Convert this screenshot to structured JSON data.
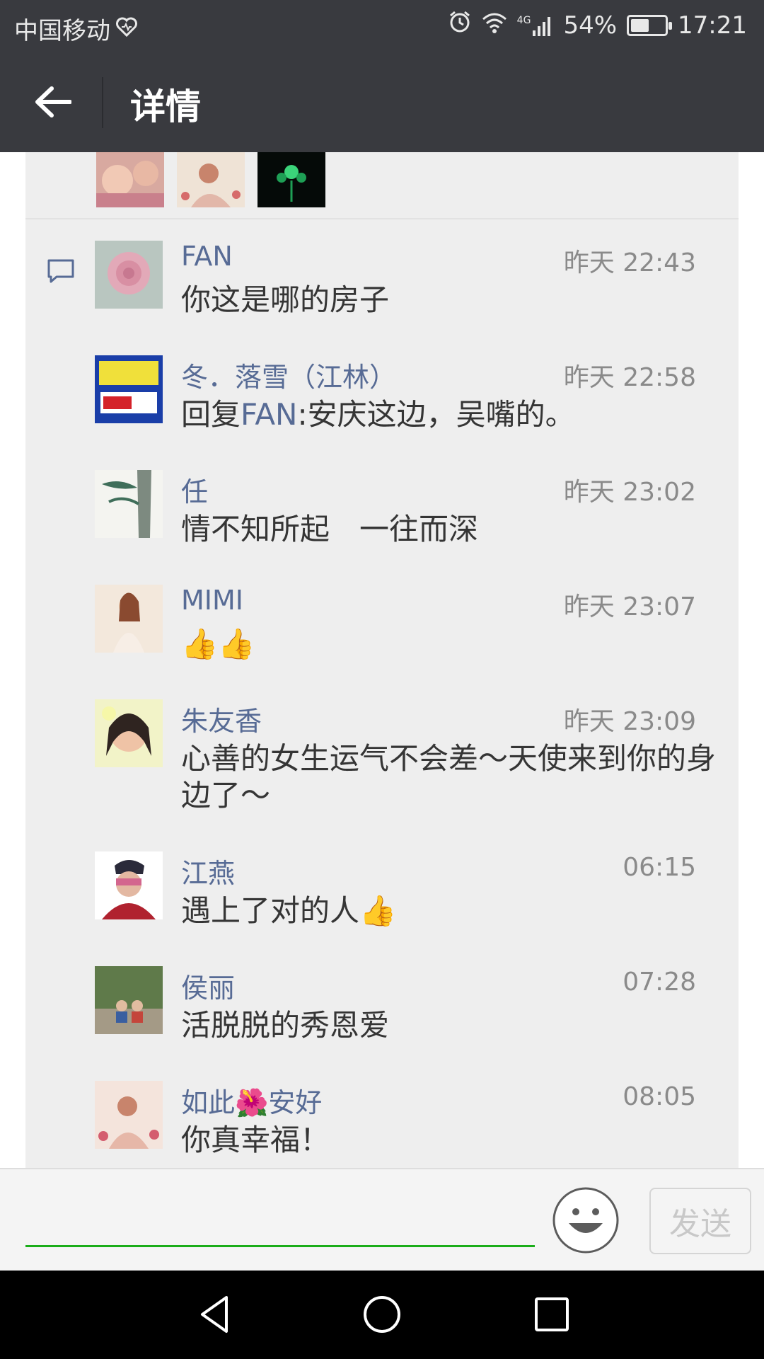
{
  "status_bar": {
    "carrier": "中国移动",
    "network": "4G",
    "battery_percent": "54%",
    "battery_level": 0.54,
    "time": "17:21"
  },
  "header": {
    "title": "详情"
  },
  "comments": [
    {
      "name": "FAN",
      "time": "昨天 22:43",
      "text": "你这是哪的房子"
    },
    {
      "name": "冬．落雪（江林）",
      "time": "昨天 22:58",
      "reply_prefix": "回复",
      "reply_to": "FAN",
      "text": ":安庆这边，吴嘴的。"
    },
    {
      "name": "任",
      "time": "昨天 23:02",
      "text": "情不知所起　一往而深"
    },
    {
      "name": "MIMI",
      "time": "昨天 23:07",
      "text": "👍👍"
    },
    {
      "name": "朱友香",
      "time": "昨天 23:09",
      "text": "心善的女生运气不会差～天使来到你的身边了～"
    },
    {
      "name": "江燕",
      "time": "06:15",
      "text": "遇上了对的人👍"
    },
    {
      "name": "侯丽",
      "time": "07:28",
      "text": "活脱脱的秀恩爱"
    },
    {
      "name": "如此🌺安好",
      "time": "08:05",
      "text": "你真幸福！"
    }
  ],
  "input": {
    "value": "",
    "send_label": "发送"
  },
  "colors": {
    "header_bg": "#393a3f",
    "name_link": "#576b95",
    "accent_green": "#1aad19",
    "panel_bg": "#eeeeee"
  }
}
